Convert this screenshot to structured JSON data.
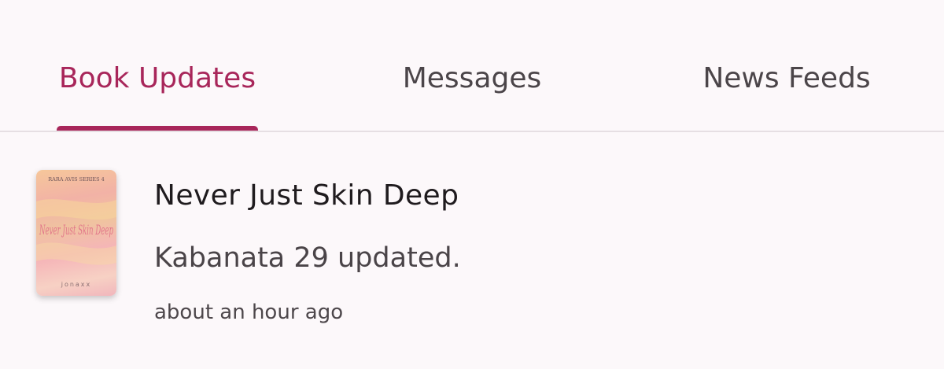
{
  "tabs": [
    {
      "label": "Book Updates",
      "active": true
    },
    {
      "label": "Messages",
      "active": false
    },
    {
      "label": "News Feeds",
      "active": false
    }
  ],
  "colors": {
    "accent": "#a8265a",
    "background": "#fcf8fa",
    "divider": "#e6dfe3",
    "title_text": "#1f1b1e",
    "secondary_text": "#4a4448"
  },
  "updates": [
    {
      "cover": {
        "series": "RARA AVIS SERIES 4",
        "title_art": "Never Just Skin Deep",
        "author": "jonaxx"
      },
      "title": "Never Just Skin Deep",
      "message": "Kabanata 29 updated.",
      "time": "about an hour ago"
    }
  ]
}
